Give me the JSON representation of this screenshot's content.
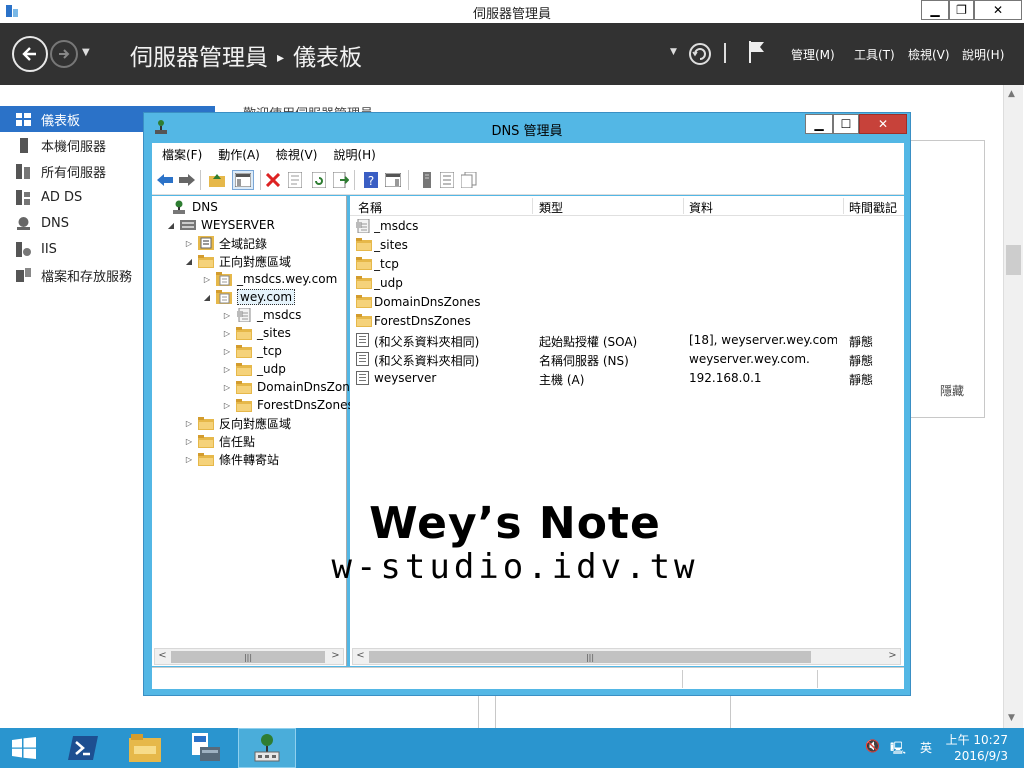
{
  "server_manager": {
    "title": "伺服器管理員",
    "breadcrumb_root": "伺服器管理員",
    "breadcrumb_sep": "▸",
    "breadcrumb_page": "儀表板",
    "menus": [
      "管理(M)",
      "工具(T)",
      "檢視(V)",
      "說明(H)"
    ],
    "nav": [
      {
        "label": "儀表板",
        "icon": "dashboard-icon",
        "active": true
      },
      {
        "label": "本機伺服器",
        "icon": "server-icon"
      },
      {
        "label": "所有伺服器",
        "icon": "servers-icon"
      },
      {
        "label": "AD DS",
        "icon": "ad-ds-icon"
      },
      {
        "label": "DNS",
        "icon": "dns-icon"
      },
      {
        "label": "IIS",
        "icon": "iis-icon"
      },
      {
        "label": "檔案和存放服務",
        "icon": "file-storage-icon"
      }
    ],
    "welcome_text": "歡迎使用伺服器管理員",
    "hide_label": "隱藏"
  },
  "dns_manager": {
    "title": "DNS 管理員",
    "menus": [
      "檔案(F)",
      "動作(A)",
      "檢視(V)",
      "說明(H)"
    ],
    "tree": [
      {
        "label": "DNS",
        "level": 0,
        "expander": "",
        "icon": "dns-root-icon"
      },
      {
        "label": "WEYSERVER",
        "level": 1,
        "expander": "◢",
        "icon": "server-icon"
      },
      {
        "label": "全域記錄",
        "level": 2,
        "expander": "▷",
        "icon": "global-logs-icon"
      },
      {
        "label": "正向對應區域",
        "level": 2,
        "expander": "◢",
        "icon": "folder-icon"
      },
      {
        "label": "_msdcs.wey.com",
        "level": 3,
        "expander": "▷",
        "icon": "zone-icon"
      },
      {
        "label": "wey.com",
        "level": 3,
        "expander": "◢",
        "icon": "zone-icon",
        "selected": true
      },
      {
        "label": "_msdcs",
        "level": 4,
        "expander": "▷",
        "icon": "delegated-zone-icon"
      },
      {
        "label": "_sites",
        "level": 4,
        "expander": "▷",
        "icon": "folder-icon"
      },
      {
        "label": "_tcp",
        "level": 4,
        "expander": "▷",
        "icon": "folder-icon"
      },
      {
        "label": "_udp",
        "level": 4,
        "expander": "▷",
        "icon": "folder-icon"
      },
      {
        "label": "DomainDnsZones",
        "level": 4,
        "expander": "▷",
        "icon": "folder-icon"
      },
      {
        "label": "ForestDnsZones",
        "level": 4,
        "expander": "▷",
        "icon": "folder-icon"
      },
      {
        "label": "反向對應區域",
        "level": 2,
        "expander": "▷",
        "icon": "folder-icon"
      },
      {
        "label": "信任點",
        "level": 2,
        "expander": "▷",
        "icon": "folder-icon"
      },
      {
        "label": "條件轉寄站",
        "level": 2,
        "expander": "▷",
        "icon": "folder-icon"
      }
    ],
    "columns": [
      "名稱",
      "類型",
      "資料",
      "時間戳記"
    ],
    "rows": [
      {
        "name": "_msdcs",
        "type": "",
        "data": "",
        "timestamp": "",
        "icon": "delegated-zone-icon"
      },
      {
        "name": "_sites",
        "type": "",
        "data": "",
        "timestamp": "",
        "icon": "folder-icon"
      },
      {
        "name": "_tcp",
        "type": "",
        "data": "",
        "timestamp": "",
        "icon": "folder-icon"
      },
      {
        "name": "_udp",
        "type": "",
        "data": "",
        "timestamp": "",
        "icon": "folder-icon"
      },
      {
        "name": "DomainDnsZones",
        "type": "",
        "data": "",
        "timestamp": "",
        "icon": "folder-icon"
      },
      {
        "name": "ForestDnsZones",
        "type": "",
        "data": "",
        "timestamp": "",
        "icon": "folder-icon"
      },
      {
        "name": "(和父系資料夾相同)",
        "type": "起始點授權 (SOA)",
        "data": "[18], weyserver.wey.com....",
        "timestamp": "靜態",
        "icon": "record-icon"
      },
      {
        "name": "(和父系資料夾相同)",
        "type": "名稱伺服器 (NS)",
        "data": "weyserver.wey.com.",
        "timestamp": "靜態",
        "icon": "record-icon"
      },
      {
        "name": "weyserver",
        "type": "主機 (A)",
        "data": "192.168.0.1",
        "timestamp": "靜態",
        "icon": "record-icon"
      }
    ]
  },
  "watermark": {
    "title": "Wey’s Note",
    "url": "w-studio.idv.tw"
  },
  "taskbar": {
    "clock_time": "上午 10:27",
    "clock_date": "2016/9/3",
    "ime": "英"
  },
  "colors": {
    "window_frame": "#53b7e5",
    "taskbar": "#2a95cf",
    "sm_header": "#323232",
    "nav_active": "#2b72c8",
    "close_button": "#c7423a"
  }
}
